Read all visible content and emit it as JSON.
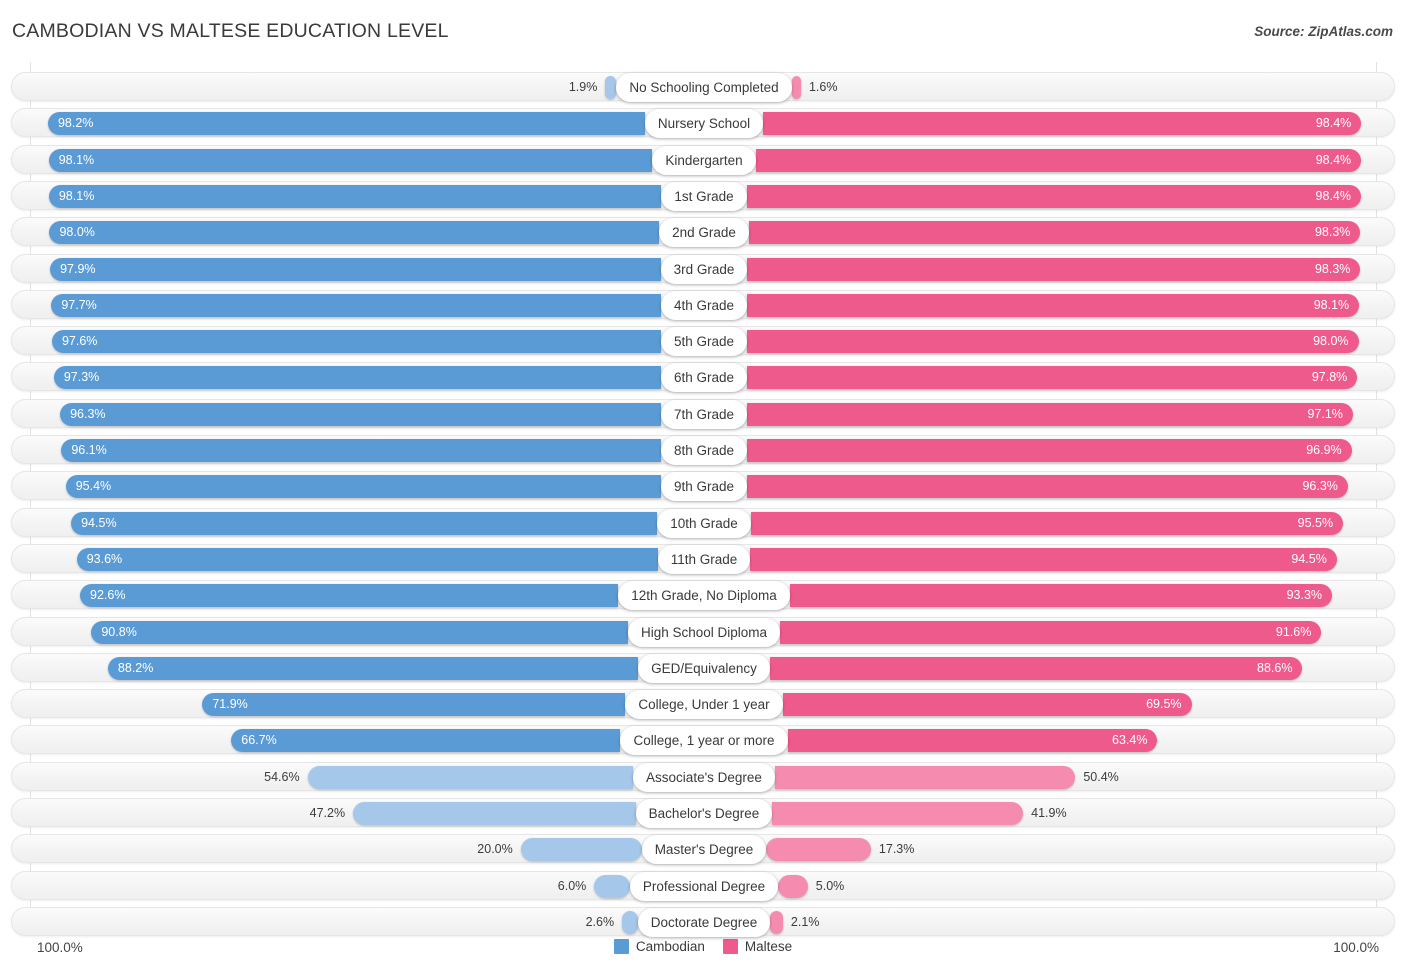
{
  "header": {
    "title": "CAMBODIAN VS MALTESE EDUCATION LEVEL",
    "source": "Source: ZipAtlas.com"
  },
  "footer": {
    "axis_left_max": "100.0%",
    "axis_right_max": "100.0%",
    "legend": [
      {
        "label": "Cambodian",
        "color": "#5b9bd5"
      },
      {
        "label": "Maltese",
        "color": "#ef5a8c"
      }
    ]
  },
  "colors": {
    "left_strong": "#5b9bd5",
    "left_light": "#a4c7ea",
    "right_strong": "#ef5a8c",
    "right_light": "#f58cb0",
    "track": "#f4f4f4",
    "grid": "#e2e2e2",
    "text": "#3c3c3c"
  },
  "chart_data": {
    "type": "bar",
    "subtype": "diverging-bidirectional",
    "title": "CAMBODIAN VS MALTESE EDUCATION LEVEL",
    "xlabel": "",
    "ylabel": "",
    "xlim": [
      0,
      100
    ],
    "grid": true,
    "legend_position": "bottom-center",
    "axis_max_label": "100.0%",
    "categories": [
      "No Schooling Completed",
      "Nursery School",
      "Kindergarten",
      "1st Grade",
      "2nd Grade",
      "3rd Grade",
      "4th Grade",
      "5th Grade",
      "6th Grade",
      "7th Grade",
      "8th Grade",
      "9th Grade",
      "10th Grade",
      "11th Grade",
      "12th Grade, No Diploma",
      "High School Diploma",
      "GED/Equivalency",
      "College, Under 1 year",
      "College, 1 year or more",
      "Associate's Degree",
      "Bachelor's Degree",
      "Master's Degree",
      "Professional Degree",
      "Doctorate Degree"
    ],
    "series": [
      {
        "name": "Cambodian",
        "side": "left",
        "color": "#5b9bd5",
        "values": [
          1.9,
          98.2,
          98.1,
          98.1,
          98.0,
          97.9,
          97.7,
          97.6,
          97.3,
          96.3,
          96.1,
          95.4,
          94.5,
          93.6,
          92.6,
          90.8,
          88.2,
          71.9,
          66.7,
          54.6,
          47.2,
          20.0,
          6.0,
          2.6
        ],
        "labels": [
          "1.9%",
          "98.2%",
          "98.1%",
          "98.1%",
          "98.0%",
          "97.9%",
          "97.7%",
          "97.6%",
          "97.3%",
          "96.3%",
          "96.1%",
          "95.4%",
          "94.5%",
          "93.6%",
          "92.6%",
          "90.8%",
          "88.2%",
          "71.9%",
          "66.7%",
          "54.6%",
          "47.2%",
          "20.0%",
          "6.0%",
          "2.6%"
        ]
      },
      {
        "name": "Maltese",
        "side": "right",
        "color": "#ef5a8c",
        "values": [
          1.6,
          98.4,
          98.4,
          98.4,
          98.3,
          98.3,
          98.1,
          98.0,
          97.8,
          97.1,
          96.9,
          96.3,
          95.5,
          94.5,
          93.3,
          91.6,
          88.6,
          69.5,
          63.4,
          50.4,
          41.9,
          17.3,
          5.0,
          2.1
        ],
        "labels": [
          "1.6%",
          "98.4%",
          "98.4%",
          "98.4%",
          "98.3%",
          "98.3%",
          "98.1%",
          "98.0%",
          "97.8%",
          "97.1%",
          "96.9%",
          "96.3%",
          "95.5%",
          "94.5%",
          "93.3%",
          "91.6%",
          "88.6%",
          "69.5%",
          "63.4%",
          "50.4%",
          "41.9%",
          "17.3%",
          "5.0%",
          "2.1%"
        ]
      }
    ]
  }
}
